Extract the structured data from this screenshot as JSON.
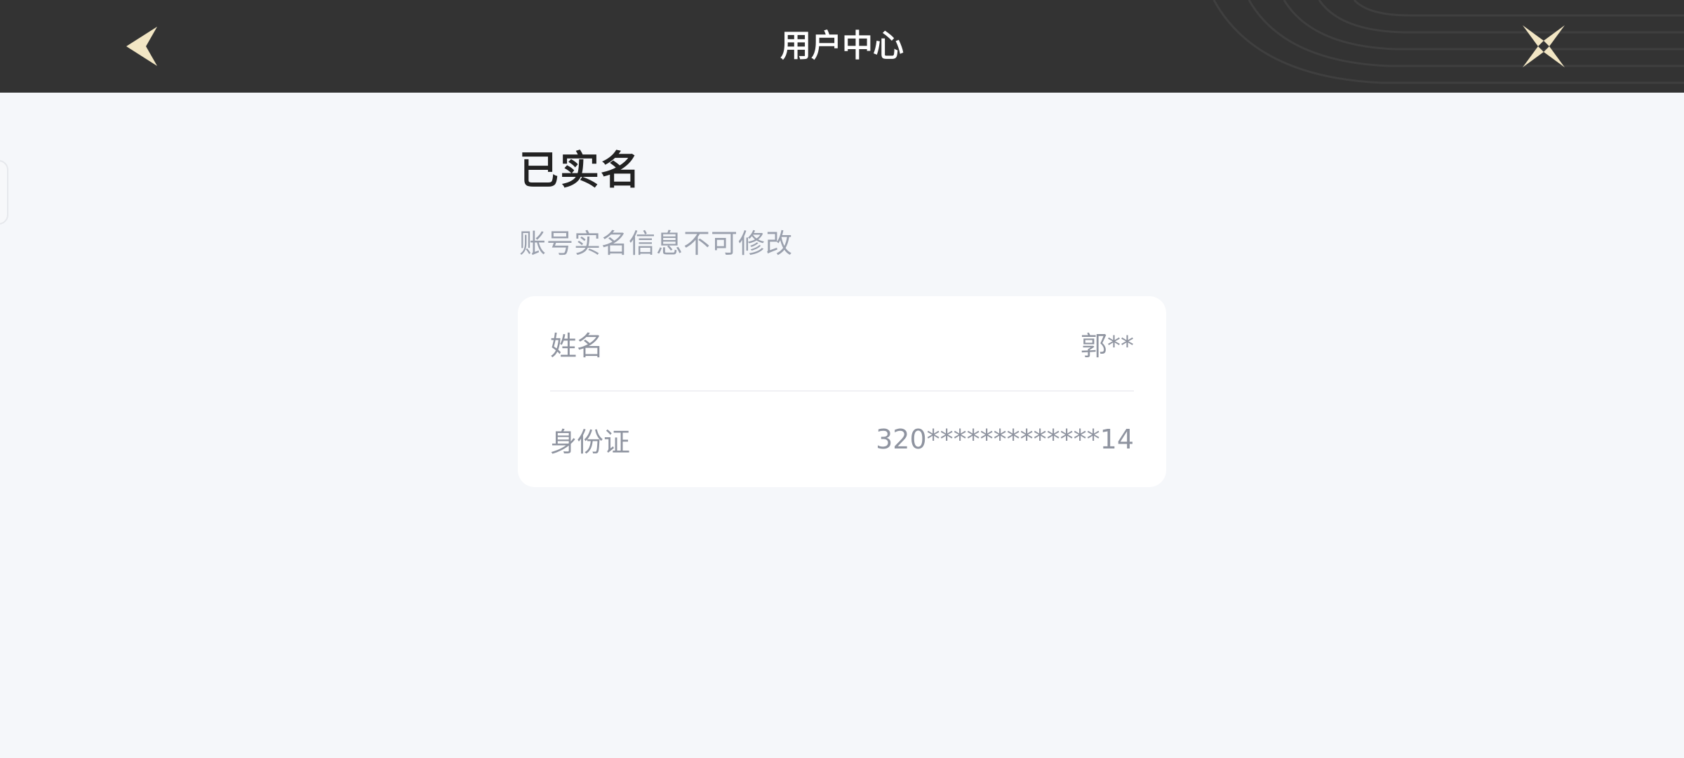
{
  "header": {
    "title": "用户中心",
    "back_icon": "chevron-left-icon",
    "close_icon": "close-x-icon",
    "accent_color": "#f2e6c4",
    "background": "#333333"
  },
  "page": {
    "title": "已实名",
    "subtitle": "账号实名信息不可修改",
    "background": "#f5f7fa"
  },
  "info_card": {
    "rows": [
      {
        "label": "姓名",
        "value": "郭**"
      },
      {
        "label": "身份证",
        "value": "320*************14"
      }
    ]
  }
}
